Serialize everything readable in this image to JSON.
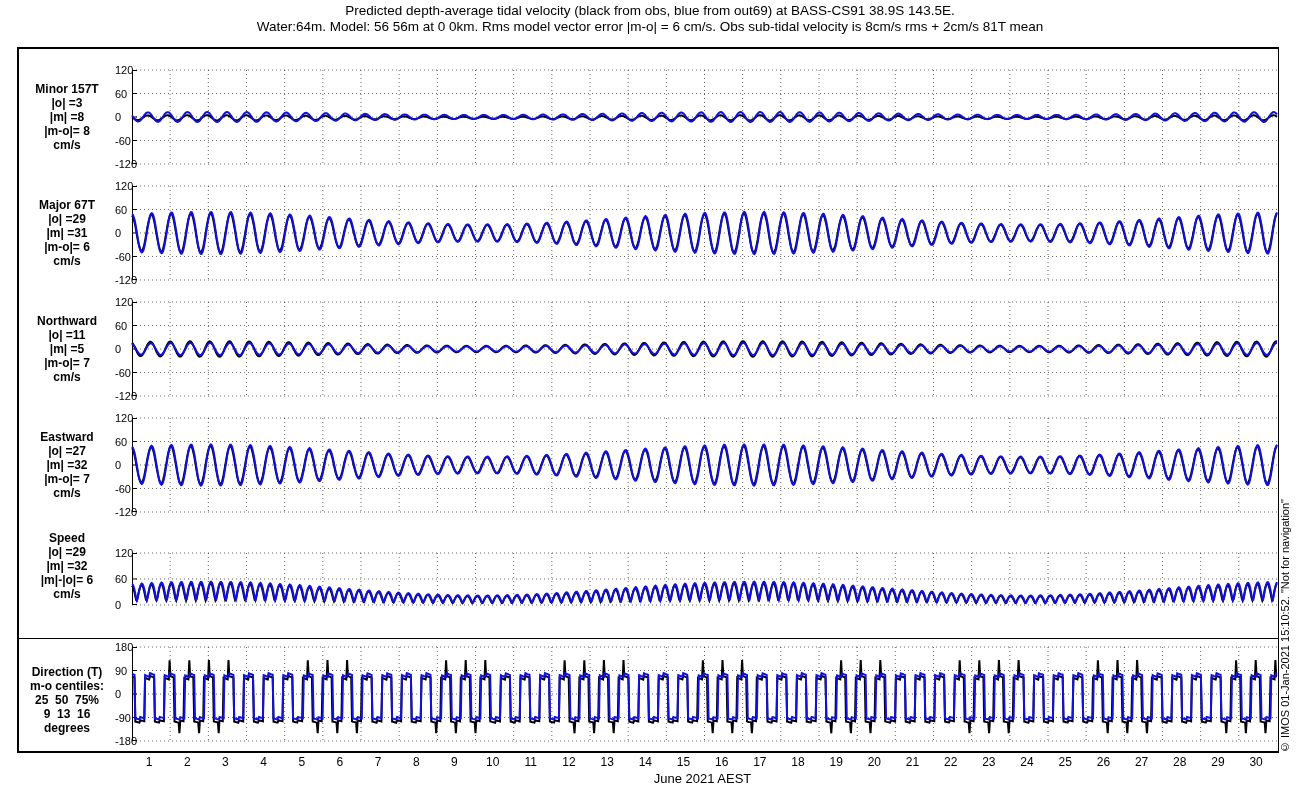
{
  "title_lines": [
    "Predicted depth-average tidal velocity (black from obs, blue from out69) at BASS-CS91 38.9S 143.5E.",
    "Water:64m. Model: 56 56m at 0 0km. Rms model vector error |m-o| = 6 cm/s. Obs sub-tidal velocity is 8cm/s rms + 2cm/s 81T mean"
  ],
  "panels": [
    {
      "kind": "minor",
      "label_lines": [
        "Minor 157T",
        "|o| =3",
        "|m| =8",
        "|m-o|= 8",
        "cm/s"
      ],
      "yticks": [
        "120",
        "60",
        "0",
        "-60",
        "-120"
      ]
    },
    {
      "kind": "major",
      "label_lines": [
        "Major 67T",
        "|o| =29",
        "|m| =31",
        "|m-o|= 6",
        "cm/s"
      ],
      "yticks": [
        "120",
        "60",
        "0",
        "-60",
        "-120"
      ]
    },
    {
      "kind": "north",
      "label_lines": [
        "Northward",
        "|o| =11",
        "|m| =5",
        "|m-o|= 7",
        "cm/s"
      ],
      "yticks": [
        "120",
        "60",
        "0",
        "-60",
        "-120"
      ]
    },
    {
      "kind": "east",
      "label_lines": [
        "Eastward",
        "|o| =27",
        "|m| =32",
        "|m-o|= 7",
        "cm/s"
      ],
      "yticks": [
        "120",
        "60",
        "0",
        "-60",
        "-120"
      ]
    },
    {
      "kind": "speed",
      "label_lines": [
        "Speed",
        "|o| =29",
        "|m| =32",
        "|m|-|o|= 6",
        "cm/s"
      ],
      "yticks": [
        "120",
        "60",
        "0"
      ]
    }
  ],
  "direction": {
    "kind": "direction",
    "label_lines": [
      "Direction (T)",
      "m-o centiles:",
      "25  50  75%",
      "9  13  16",
      "degrees"
    ],
    "yticks": [
      "180",
      "90",
      "0",
      "-90",
      "-180"
    ]
  },
  "xticks": [
    "1",
    "2",
    "3",
    "4",
    "5",
    "6",
    "7",
    "8",
    "9",
    "10",
    "11",
    "12",
    "13",
    "14",
    "15",
    "16",
    "17",
    "18",
    "19",
    "20",
    "21",
    "22",
    "23",
    "24",
    "25",
    "26",
    "27",
    "28",
    "29",
    "30"
  ],
  "xlabel": "June 2021 AEST",
  "side_note": "© IMOS 01-Jan-2021 15:10:52. \"Not for navigation\""
}
